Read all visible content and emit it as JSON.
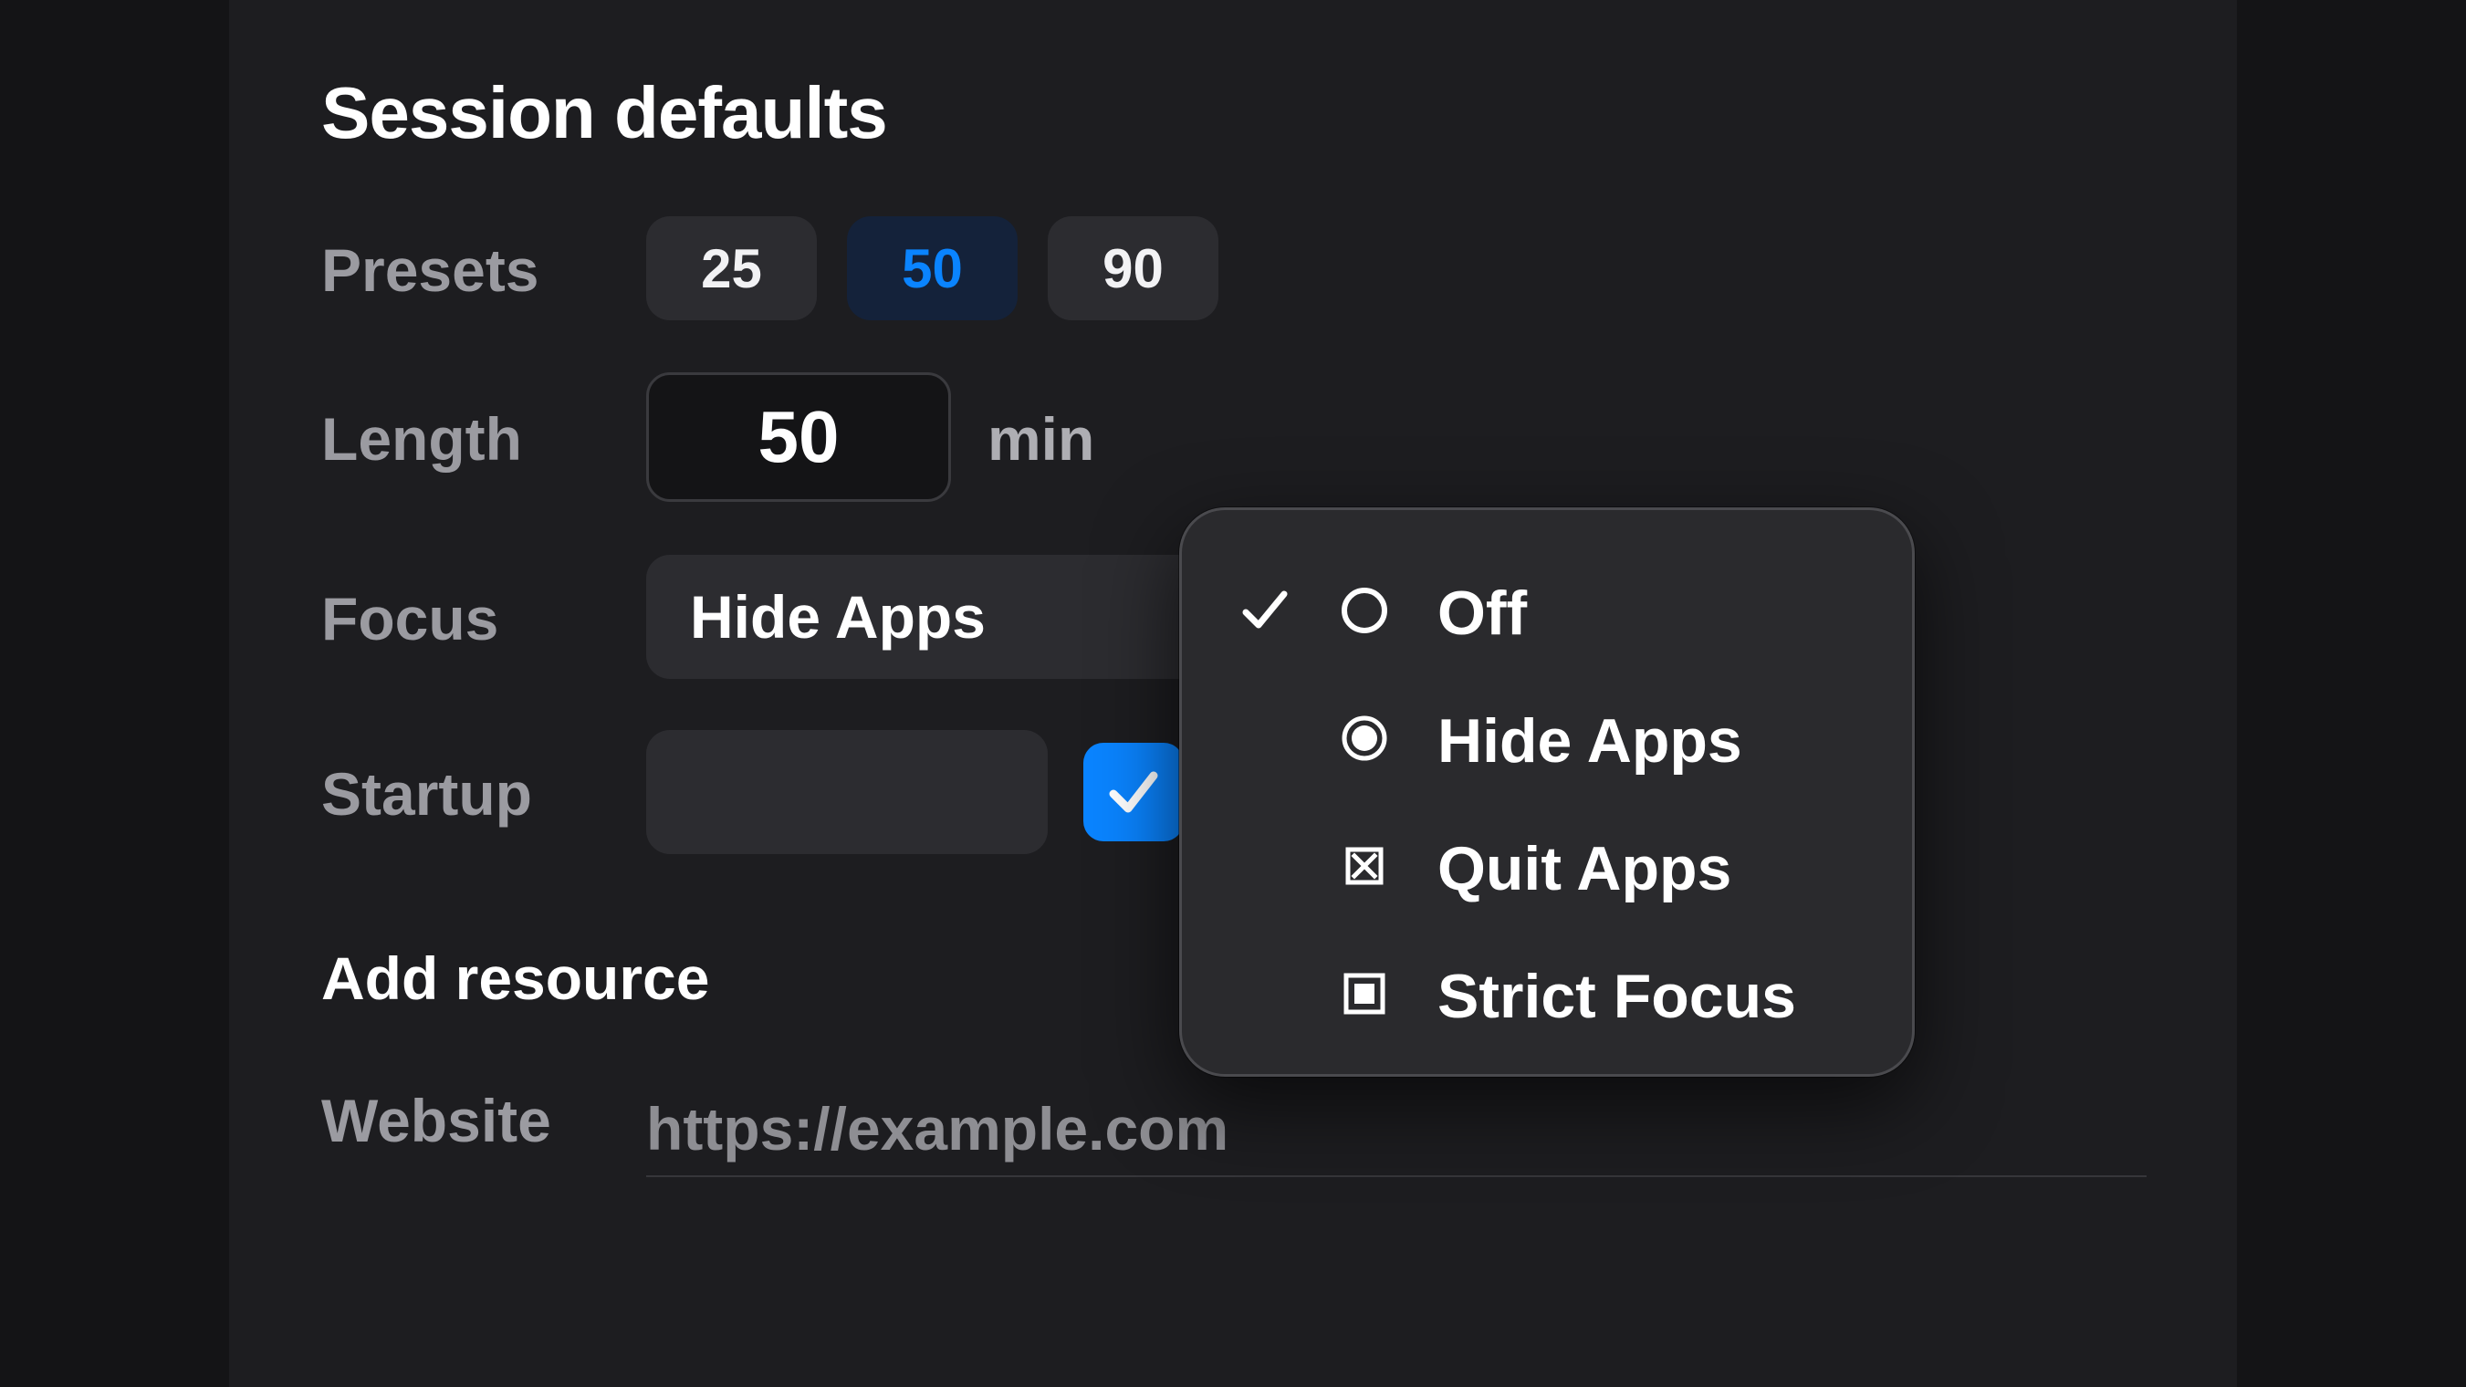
{
  "section": {
    "title": "Session defaults"
  },
  "presets": {
    "label": "Presets",
    "options": [
      "25",
      "50",
      "90"
    ],
    "selected": "50"
  },
  "length": {
    "label": "Length",
    "value": "50",
    "unit": "min"
  },
  "focus": {
    "label": "Focus",
    "value": "Hide Apps",
    "menu": [
      {
        "label": "Off",
        "icon": "circle-outline-icon",
        "checked": true
      },
      {
        "label": "Hide Apps",
        "icon": "radio-filled-icon",
        "checked": false
      },
      {
        "label": "Quit Apps",
        "icon": "boxed-x-icon",
        "checked": false
      },
      {
        "label": "Strict Focus",
        "icon": "boxed-square-icon",
        "checked": false
      }
    ]
  },
  "startup": {
    "label": "Startup",
    "field_value": "",
    "checked": true
  },
  "add_resource": {
    "heading": "Add resource",
    "website_label": "Website",
    "website_placeholder": "https://example.com"
  },
  "colors": {
    "accent": "#0a84ff",
    "panel": "#1d1d20",
    "control": "#2c2c30",
    "label": "#9b9ba1"
  }
}
